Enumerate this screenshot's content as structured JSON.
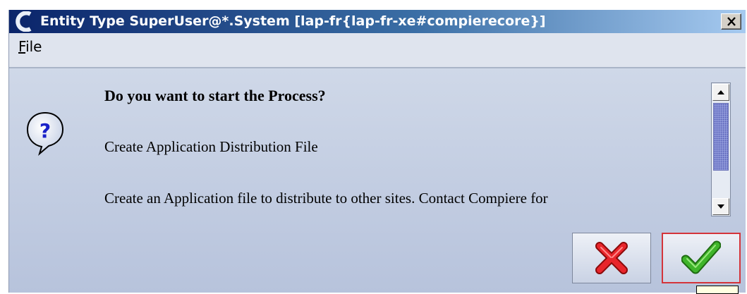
{
  "window": {
    "title": "Entity Type  SuperUser@*.System [lap-fr{lap-fr-xe#compierecore}]",
    "logo_icon": "compiere-logo-icon",
    "close_icon": "close-x-icon"
  },
  "menubar": {
    "file_mnemonic": "F",
    "file_rest": "ile"
  },
  "dialog": {
    "icon": "question-mark-icon",
    "question": "Do you want to start the Process?",
    "process_name": "Create Application Distribution File",
    "process_description": "Create an Application file to distribute to other sites. Contact Compiere for"
  },
  "scrollbar": {
    "up_icon": "arrow-up-icon",
    "down_icon": "arrow-down-icon"
  },
  "buttons": {
    "cancel_icon": "red-x-icon",
    "ok_icon": "green-check-icon"
  },
  "colors": {
    "title_gradient_start": "#0a246a",
    "title_gradient_end": "#a6caf0",
    "content_bg": "#cfd8e8",
    "ok_border": "#d4343a"
  }
}
